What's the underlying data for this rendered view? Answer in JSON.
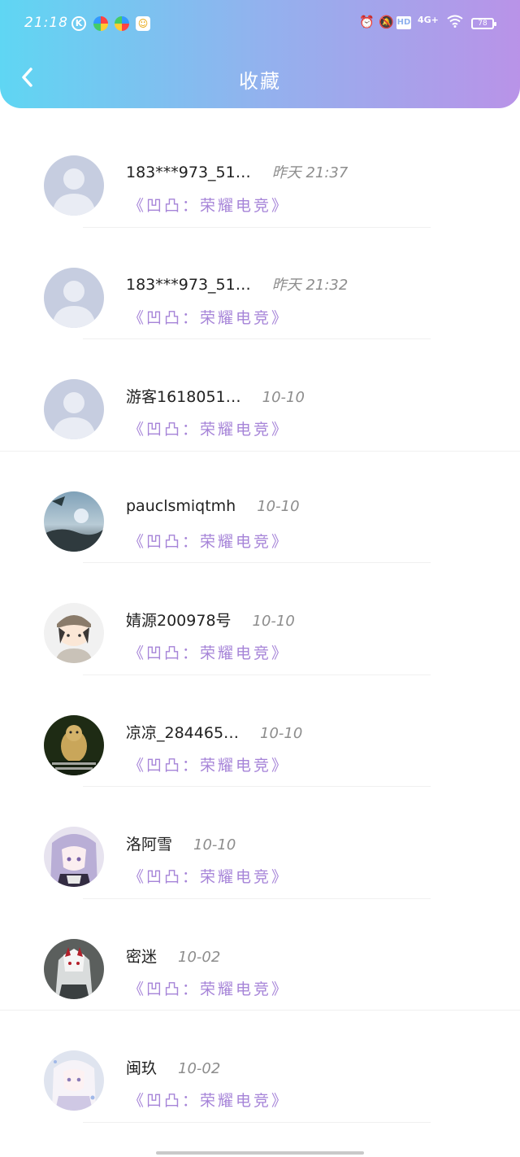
{
  "status_bar": {
    "time": "21:18",
    "apps": [
      "k-app-icon",
      "colorful-app-icon",
      "colorful-app-icon-2",
      "dog-app-icon"
    ],
    "network": "4G+",
    "hd": "HD",
    "battery": "78"
  },
  "header": {
    "title": "收藏",
    "back_icon": "chevron-left-icon"
  },
  "favorites": [
    {
      "name": "183***973_51…",
      "date": "昨天 21:37",
      "game": "《凹凸：荣耀电竞》",
      "avatar": "default"
    },
    {
      "name": "183***973_51…",
      "date": "昨天 21:32",
      "game": "《凹凸：荣耀电竞》",
      "avatar": "default"
    },
    {
      "name": "游客1618051…",
      "date": "10-10",
      "game": "《凹凸：荣耀电竞》",
      "avatar": "default"
    },
    {
      "name": "pauclsmiqtmh",
      "date": "10-10",
      "game": "《凹凸：荣耀电竞》",
      "avatar": "landscape"
    },
    {
      "name": "婧源200978号",
      "date": "10-10",
      "game": "《凹凸：荣耀电竞》",
      "avatar": "boy"
    },
    {
      "name": "凉凉_284465…",
      "date": "10-10",
      "game": "《凹凸：荣耀电竞》",
      "avatar": "hamster"
    },
    {
      "name": "洛阿雪",
      "date": "10-10",
      "game": "《凹凸：荣耀电竞》",
      "avatar": "anime-purple"
    },
    {
      "name": "密迷",
      "date": "10-02",
      "game": "《凹凸：荣耀电竞》",
      "avatar": "anime-mask"
    },
    {
      "name": "闽玖",
      "date": "10-02",
      "game": "《凹凸：荣耀电竞》",
      "avatar": "anime-white"
    }
  ],
  "colors": {
    "header_gradient": [
      "#5fd6f3",
      "#92b2ee",
      "#b993e8"
    ],
    "game_text": "#a684d8",
    "date_text": "#8d8d8d"
  }
}
